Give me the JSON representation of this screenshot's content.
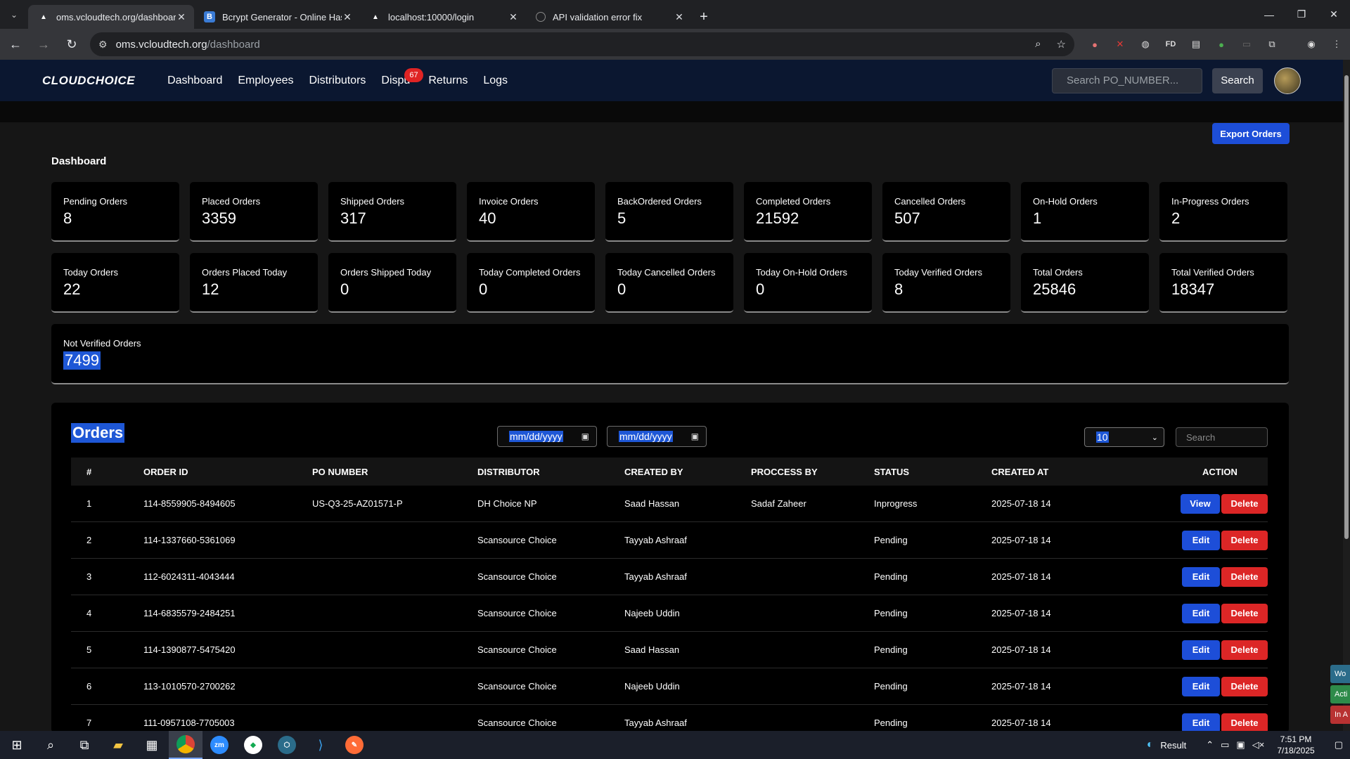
{
  "browser": {
    "tabs": [
      {
        "title": "oms.vcloudtech.org/dashboard",
        "favicon": "triangle-icon",
        "active": true
      },
      {
        "title": "Bcrypt Generator - Online Hash",
        "favicon": "b-icon",
        "active": false
      },
      {
        "title": "localhost:10000/login",
        "favicon": "triangle-icon",
        "active": false
      },
      {
        "title": "API validation error fix",
        "favicon": "circle-icon",
        "active": false
      }
    ],
    "url_host": "oms.vcloudtech.org",
    "url_path": "/dashboard"
  },
  "app": {
    "logo": "CLOUDCHOICE",
    "nav": [
      "Dashboard",
      "Employees",
      "Distributors",
      "Dispu",
      "Returns",
      "Logs"
    ],
    "disputes_badge": "67",
    "search_placeholder": "Search PO_NUMBER...",
    "search_button": "Search",
    "export_button": "Export Orders"
  },
  "dashboard": {
    "title": "Dashboard",
    "row1": [
      {
        "label": "Pending Orders",
        "value": "8"
      },
      {
        "label": "Placed Orders",
        "value": "3359"
      },
      {
        "label": "Shipped Orders",
        "value": "317"
      },
      {
        "label": "Invoice Orders",
        "value": "40"
      },
      {
        "label": "BackOrdered Orders",
        "value": "5"
      },
      {
        "label": "Completed Orders",
        "value": "21592"
      },
      {
        "label": "Cancelled Orders",
        "value": "507"
      },
      {
        "label": "On-Hold Orders",
        "value": "1"
      },
      {
        "label": "In-Progress Orders",
        "value": "2"
      }
    ],
    "row2": [
      {
        "label": "Today Orders",
        "value": "22"
      },
      {
        "label": "Orders Placed Today",
        "value": "12"
      },
      {
        "label": "Orders Shipped Today",
        "value": "0"
      },
      {
        "label": "Today Completed Orders",
        "value": "0"
      },
      {
        "label": "Today Cancelled Orders",
        "value": "0"
      },
      {
        "label": "Today On-Hold Orders",
        "value": "0"
      },
      {
        "label": "Today Verified Orders",
        "value": "8"
      },
      {
        "label": "Total Orders",
        "value": "25846"
      },
      {
        "label": "Total Verified Orders",
        "value": "18347"
      }
    ],
    "not_verified": {
      "label": "Not Verified Orders",
      "value": "7499"
    }
  },
  "orders": {
    "title": "Orders",
    "date_from_placeholder": "mm/dd/yyyy",
    "date_to_placeholder": "mm/dd/yyyy",
    "page_size": "10",
    "search_placeholder": "Search",
    "columns": [
      "#",
      "ORDER ID",
      "PO NUMBER",
      "DISTRIBUTOR",
      "CREATED BY",
      "PROCCESS BY",
      "STATUS",
      "CREATED AT",
      "ACTION"
    ],
    "rows": [
      {
        "n": "1",
        "order_id": "114-8559905-8494605",
        "po": "US-Q3-25-AZ01571-P",
        "distributor": "DH Choice NP",
        "created_by": "Saad Hassan",
        "process_by": "Sadaf Zaheer",
        "status": "Inprogress",
        "created_at": "2025-07-18 14",
        "primary_action": "View",
        "secondary_action": "Delete"
      },
      {
        "n": "2",
        "order_id": "114-1337660-5361069",
        "po": "",
        "distributor": "Scansource Choice",
        "created_by": "Tayyab Ashraaf",
        "process_by": "",
        "status": "Pending",
        "created_at": "2025-07-18 14",
        "primary_action": "Edit",
        "secondary_action": "Delete"
      },
      {
        "n": "3",
        "order_id": "112-6024311-4043444",
        "po": "",
        "distributor": "Scansource Choice",
        "created_by": "Tayyab Ashraaf",
        "process_by": "",
        "status": "Pending",
        "created_at": "2025-07-18 14",
        "primary_action": "Edit",
        "secondary_action": "Delete"
      },
      {
        "n": "4",
        "order_id": "114-6835579-2484251",
        "po": "",
        "distributor": "Scansource Choice",
        "created_by": "Najeeb Uddin",
        "process_by": "",
        "status": "Pending",
        "created_at": "2025-07-18 14",
        "primary_action": "Edit",
        "secondary_action": "Delete"
      },
      {
        "n": "5",
        "order_id": "114-1390877-5475420",
        "po": "",
        "distributor": "Scansource Choice",
        "created_by": "Saad Hassan",
        "process_by": "",
        "status": "Pending",
        "created_at": "2025-07-18 14",
        "primary_action": "Edit",
        "secondary_action": "Delete"
      },
      {
        "n": "6",
        "order_id": "113-1010570-2700262",
        "po": "",
        "distributor": "Scansource Choice",
        "created_by": "Najeeb Uddin",
        "process_by": "",
        "status": "Pending",
        "created_at": "2025-07-18 14",
        "primary_action": "Edit",
        "secondary_action": "Delete"
      },
      {
        "n": "7",
        "order_id": "111-0957108-7705003",
        "po": "",
        "distributor": "Scansource Choice",
        "created_by": "Tayyab Ashraaf",
        "process_by": "",
        "status": "Pending",
        "created_at": "2025-07-18 14",
        "primary_action": "Edit",
        "secondary_action": "Delete"
      }
    ]
  },
  "side_tags": [
    "Wo",
    "Acti",
    "In A"
  ],
  "taskbar": {
    "weather_label": "Result",
    "time": "7:51 PM",
    "date": "7/18/2025"
  },
  "colors": {
    "accent": "#1d4ed8",
    "danger": "#dc2626",
    "header_bg": "#0b1730",
    "badge": "#e02424"
  }
}
